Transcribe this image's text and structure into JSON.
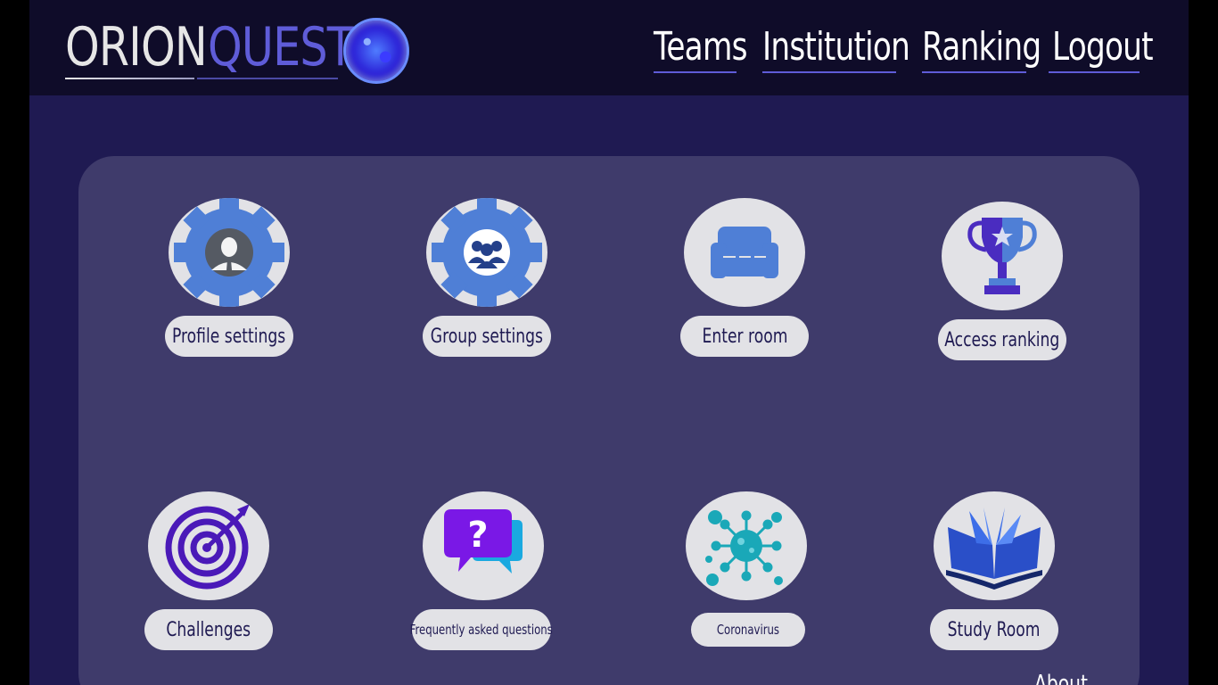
{
  "brand": {
    "word1": "ORION",
    "word2": "QUEST",
    "logo_icon": "planet-orb-icon"
  },
  "nav": [
    {
      "label": "Teams"
    },
    {
      "label": "Institution"
    },
    {
      "label": "Ranking"
    },
    {
      "label": "Logout"
    }
  ],
  "tiles": [
    {
      "label": "Profile settings",
      "icon": "profile-gear-icon"
    },
    {
      "label": "Group settings",
      "icon": "group-gear-icon"
    },
    {
      "label": "Enter room",
      "icon": "sofa-icon"
    },
    {
      "label": "Access ranking",
      "icon": "trophy-icon"
    },
    {
      "label": "Challenges",
      "icon": "target-icon"
    },
    {
      "label": "Frequently asked questions",
      "icon": "chat-question-icon"
    },
    {
      "label": "Coronavirus",
      "icon": "virus-icon"
    },
    {
      "label": "Study Room",
      "icon": "open-book-icon"
    }
  ],
  "footer": {
    "about_label": "About"
  },
  "colors": {
    "page_bg": "#1f1a52",
    "topbar_bg": "#0f0c29",
    "panel_bg": "#3f3b6b",
    "accent": "#5f5cd8",
    "tile_bg": "#e2e2e6"
  }
}
